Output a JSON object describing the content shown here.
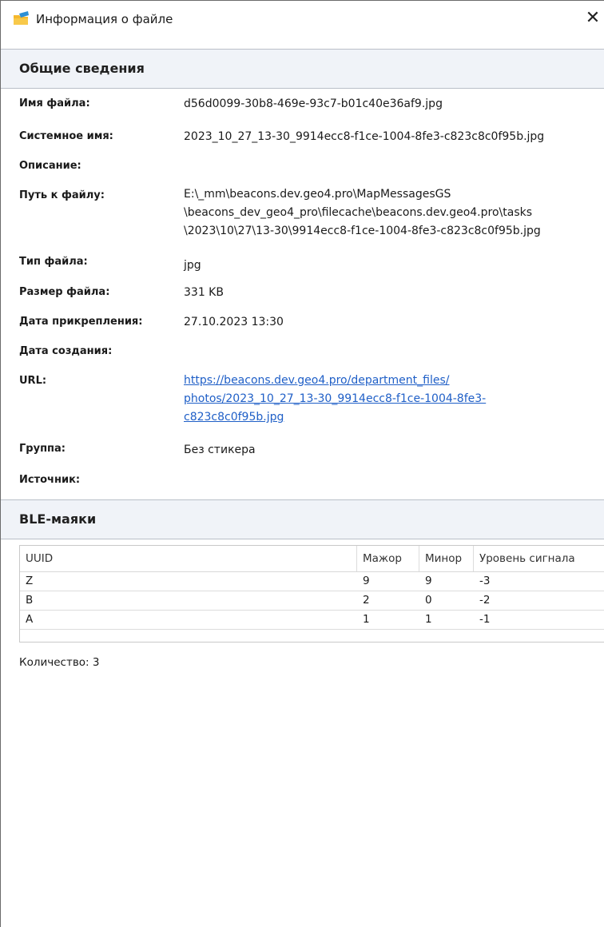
{
  "window": {
    "title": "Информация о файле",
    "close_glyph": "✕",
    "icon": "folder-icon"
  },
  "general": {
    "section_title": "Общие сведения",
    "fields": [
      {
        "label": "Имя файла:",
        "value": "d56d0099-30b8-469e-93c7-b01c40e36af9.jpg"
      },
      {
        "label": "Системное имя:",
        "value": "2023_10_27_13-30_9914ecc8-f1ce-1004-8fe3-c823c8c0f95b.jpg"
      },
      {
        "label": "Описание:",
        "value": ""
      },
      {
        "label": "Путь к файлу:",
        "value_lines": [
          "E:\\_mm\\beacons.dev.geo4.pro\\MapMessagesGS",
          "\\beacons_dev_geo4_pro\\filecache\\beacons.dev.geo4.pro\\tasks",
          "\\2023\\10\\27\\13-30\\9914ecc8-f1ce-1004-8fe3-c823c8c0f95b.jpg"
        ]
      },
      {
        "label": "Тип файла:",
        "value": "jpg"
      },
      {
        "label": "Размер файла:",
        "value": "331 KB"
      },
      {
        "label": "Дата прикрепления:",
        "value": "27.10.2023 13:30"
      },
      {
        "label": "Дата создания:",
        "value": ""
      },
      {
        "label": "URL:",
        "link_lines": [
          "https://beacons.dev.geo4.pro/department_files/",
          "photos/2023_10_27_13-30_9914ecc8-f1ce-1004-8fe3-",
          "c823c8c0f95b.jpg"
        ]
      },
      {
        "label": "Группа:",
        "value": "Без стикера"
      },
      {
        "label": "Источник:",
        "value": ""
      }
    ]
  },
  "ble": {
    "section_title": "BLE-маяки",
    "columns": [
      "UUID",
      "Мажор",
      "Минор",
      "Уровень сигнала"
    ],
    "rows": [
      [
        "Z",
        "9",
        "9",
        "-3"
      ],
      [
        "B",
        "2",
        "0",
        "-2"
      ],
      [
        "A",
        "1",
        "1",
        "-1"
      ]
    ],
    "count_text": "Количество: 3"
  },
  "colors": {
    "section_bg": "#f0f3f8",
    "link": "#1f5fc7",
    "icon_folder": "#f5b82e",
    "icon_accent": "#2d8fd5"
  }
}
